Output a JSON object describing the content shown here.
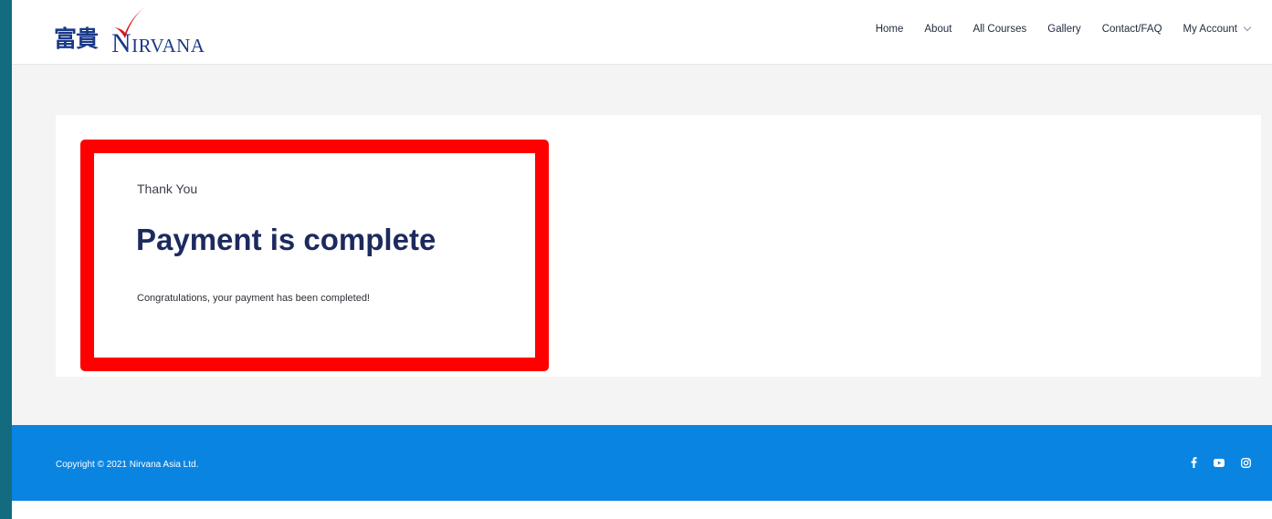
{
  "header": {
    "logo_cjk": "富貴",
    "logo_initial": "N",
    "logo_rest": "IRVANA"
  },
  "nav": {
    "items": [
      "Home",
      "About",
      "All Courses",
      "Gallery",
      "Contact/FAQ",
      "My Account"
    ]
  },
  "main": {
    "subtitle": "Thank You",
    "title": "Payment is complete",
    "message": "Congratulations, your payment has been completed!"
  },
  "footer": {
    "copyright": "Copyright © 2021 Nirvana Asia Ltd.",
    "social_icons": [
      "facebook-icon",
      "youtube-icon",
      "instagram-icon"
    ]
  },
  "colors": {
    "header_bg": "#ffffff",
    "title": "#1d2a5e",
    "highlight_border": "#ff0000",
    "footer_bg": "#0a84e1",
    "frame": "#136b80"
  }
}
